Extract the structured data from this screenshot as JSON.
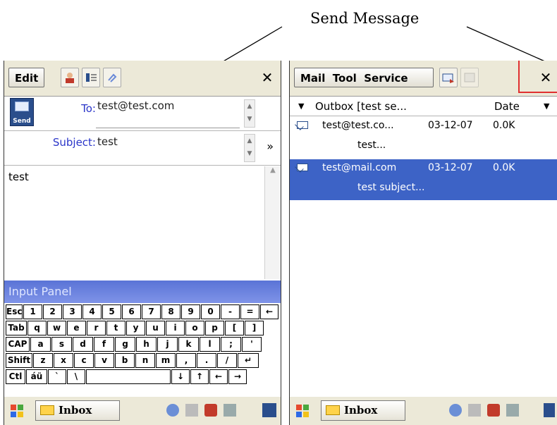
{
  "callout": {
    "text": "Send Message"
  },
  "left": {
    "menu": {
      "edit": "Edit"
    },
    "to_label": "To:",
    "to_value": "test@test.com",
    "subject_label": "Subject:",
    "subject_value": "test",
    "send_label": "Send",
    "body_text": "test",
    "input_panel_title": "Input Panel",
    "keyboard_rows": [
      [
        "Esc",
        "1",
        "2",
        "3",
        "4",
        "5",
        "6",
        "7",
        "8",
        "9",
        "0",
        "-",
        "=",
        "←"
      ],
      [
        "Tab",
        "q",
        "w",
        "e",
        "r",
        "t",
        "y",
        "u",
        "i",
        "o",
        "p",
        "[",
        "]"
      ],
      [
        "CAP",
        "a",
        "s",
        "d",
        "f",
        "g",
        "h",
        "j",
        "k",
        "l",
        ";",
        "'"
      ],
      [
        "Shift",
        "z",
        "x",
        "c",
        "v",
        "b",
        "n",
        "m",
        ",",
        ".",
        "/",
        "↵"
      ],
      [
        "Ctl",
        "áü",
        "`",
        "\\",
        " ",
        "↓",
        "↑",
        "←",
        "→"
      ]
    ]
  },
  "right": {
    "menu": {
      "mail": "Mail",
      "tool": "Tool",
      "service": "Service"
    },
    "folder_label": "Outbox [test se...",
    "sort_label": "Date",
    "messages": [
      {
        "from": "test@test.co...",
        "date": "03-12-07",
        "size": "0.0K",
        "subject": "test...",
        "selected": false
      },
      {
        "from": "test@mail.com",
        "date": "03-12-07",
        "size": "0.0K",
        "subject": "test subject...",
        "selected": true
      }
    ]
  },
  "taskbar": {
    "inbox_label": "Inbox"
  },
  "colors": {
    "highlight": "#3d63c6",
    "label_blue": "#2b36c9",
    "annotation_red": "#e03030",
    "panel_blue": "#6a80e0"
  }
}
